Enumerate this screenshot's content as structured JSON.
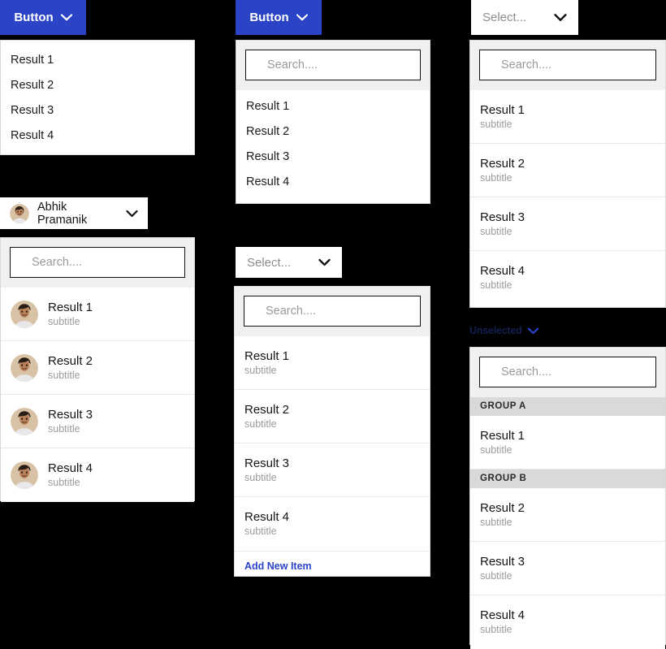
{
  "theme": {
    "accent_blue": "#2b44c7",
    "panel_bg": "#ffffff",
    "search_zone_bg": "#f0f0f0",
    "group_header_bg": "#d9d9d9",
    "page_bg": "#000000",
    "subtitle_color": "#9b9b9b"
  },
  "column1": {
    "button": {
      "label": "Button",
      "icon": "chevron-down-icon"
    },
    "simple_dropdown": {
      "items": [
        {
          "label": "Result 1"
        },
        {
          "label": "Result 2"
        },
        {
          "label": "Result 3"
        },
        {
          "label": "Result 4"
        }
      ]
    },
    "user_trigger": {
      "name": "Abhik Pramanik",
      "avatar": "user-photo-avatar",
      "icon": "chevron-down-icon"
    },
    "user_dropdown": {
      "search": {
        "placeholder": "Search...."
      },
      "items": [
        {
          "title": "Result 1",
          "subtitle": "subtitle",
          "avatar": "user-photo-avatar"
        },
        {
          "title": "Result 2",
          "subtitle": "subtitle",
          "avatar": "user-photo-avatar"
        },
        {
          "title": "Result 3",
          "subtitle": "subtitle",
          "avatar": "user-photo-avatar"
        },
        {
          "title": "Result 4",
          "subtitle": "subtitle",
          "avatar": "user-photo-avatar"
        }
      ]
    }
  },
  "column2": {
    "button": {
      "label": "Button",
      "icon": "chevron-down-icon"
    },
    "search_dropdown": {
      "search": {
        "placeholder": "Search...."
      },
      "items": [
        {
          "label": "Result 1"
        },
        {
          "label": "Result 2"
        },
        {
          "label": "Result 3"
        },
        {
          "label": "Result 4"
        }
      ]
    },
    "select_trigger": {
      "label": "Select...",
      "icon": "chevron-down-icon"
    },
    "subtitle_dropdown": {
      "search": {
        "placeholder": "Search...."
      },
      "items": [
        {
          "title": "Result 1",
          "subtitle": "subtitle"
        },
        {
          "title": "Result 2",
          "subtitle": "subtitle"
        },
        {
          "title": "Result 3",
          "subtitle": "subtitle"
        },
        {
          "title": "Result 4",
          "subtitle": "subtitle"
        }
      ],
      "footer_action": "Add New Item"
    }
  },
  "column3": {
    "select_trigger": {
      "label": "Select...",
      "icon": "chevron-down-icon"
    },
    "subtitle_dropdown": {
      "search": {
        "placeholder": "Search...."
      },
      "items": [
        {
          "title": "Result 1",
          "subtitle": "subtitle"
        },
        {
          "title": "Result 2",
          "subtitle": "subtitle"
        },
        {
          "title": "Result 3",
          "subtitle": "subtitle"
        },
        {
          "title": "Result 4",
          "subtitle": "subtitle"
        }
      ]
    },
    "ghost_trigger": {
      "label": "Unselected",
      "icon": "chevron-down-icon"
    },
    "grouped_dropdown": {
      "search": {
        "placeholder": "Search...."
      },
      "groups": [
        {
          "header": "GROUP A",
          "items": [
            {
              "title": "Result 1",
              "subtitle": "subtitle"
            }
          ]
        },
        {
          "header": "GROUP B",
          "items": [
            {
              "title": "Result 2",
              "subtitle": "subtitle"
            },
            {
              "title": "Result 3",
              "subtitle": "subtitle"
            },
            {
              "title": "Result 4",
              "subtitle": "subtitle"
            }
          ]
        }
      ]
    }
  }
}
